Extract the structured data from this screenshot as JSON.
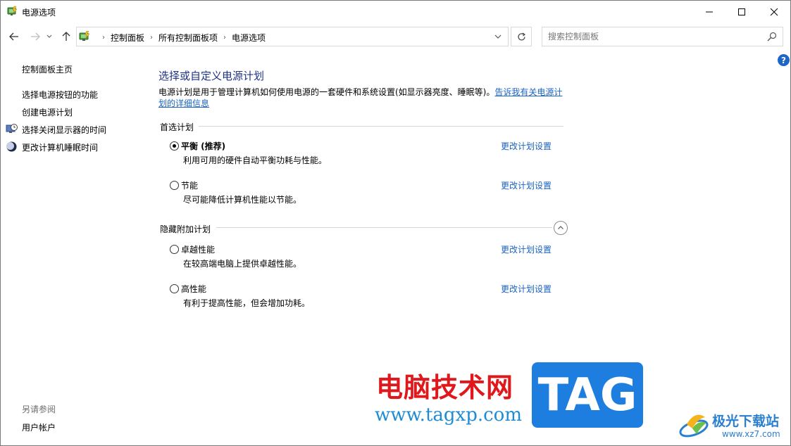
{
  "window": {
    "title": "电源选项"
  },
  "address_bar": {
    "crumbs": [
      "控制面板",
      "所有控制面板项",
      "电源选项"
    ]
  },
  "search": {
    "placeholder": "搜索控制面板"
  },
  "help": {
    "label": "?"
  },
  "left_nav": {
    "home": "控制面板主页",
    "items": [
      {
        "label": "选择电源按钮的功能",
        "icon": null
      },
      {
        "label": "创建电源计划",
        "icon": null
      },
      {
        "label": "选择关闭显示器的时间",
        "icon": "monitor-clock-icon"
      },
      {
        "label": "更改计算机睡眠时间",
        "icon": "moon-sleep-icon"
      }
    ],
    "see_also_heading": "另请参阅",
    "see_also_items": [
      "用户帐户"
    ]
  },
  "main": {
    "title": "选择或自定义电源计划",
    "description": "电源计划是用于管理计算机如何使用电源的一套硬件和系统设置(如显示器亮度、睡眠等)。",
    "description_link": "告诉我有关电源计划的详细信息",
    "preferred_heading": "首选计划",
    "hidden_heading": "隐藏附加计划",
    "preferred_plans": [
      {
        "name": "平衡 (推荐)",
        "desc": "利用可用的硬件自动平衡功耗与性能。",
        "link": "更改计划设置",
        "selected": true
      },
      {
        "name": "节能",
        "desc": "尽可能降低计算机性能以节能。",
        "link": "更改计划设置",
        "selected": false
      }
    ],
    "hidden_plans": [
      {
        "name": "卓越性能",
        "desc": "在较高端电脑上提供卓越性能。",
        "link": "更改计划设置",
        "selected": false
      },
      {
        "name": "高性能",
        "desc": "有利于提高性能，但会增加功耗。",
        "link": "更改计划设置",
        "selected": false
      }
    ]
  },
  "watermark": {
    "site_name": "电脑技术网",
    "site_url": "www.tagxp.com",
    "tag": "TAG",
    "partner_name": "极光下载站",
    "partner_url": "www.xz7.com"
  },
  "colors": {
    "title_blue": "#1e3287",
    "link_blue": "#1a63c2",
    "help_blue": "#1c66c9",
    "watermark_red": "#e0181b",
    "tag_blue": "#1e7ee0"
  }
}
